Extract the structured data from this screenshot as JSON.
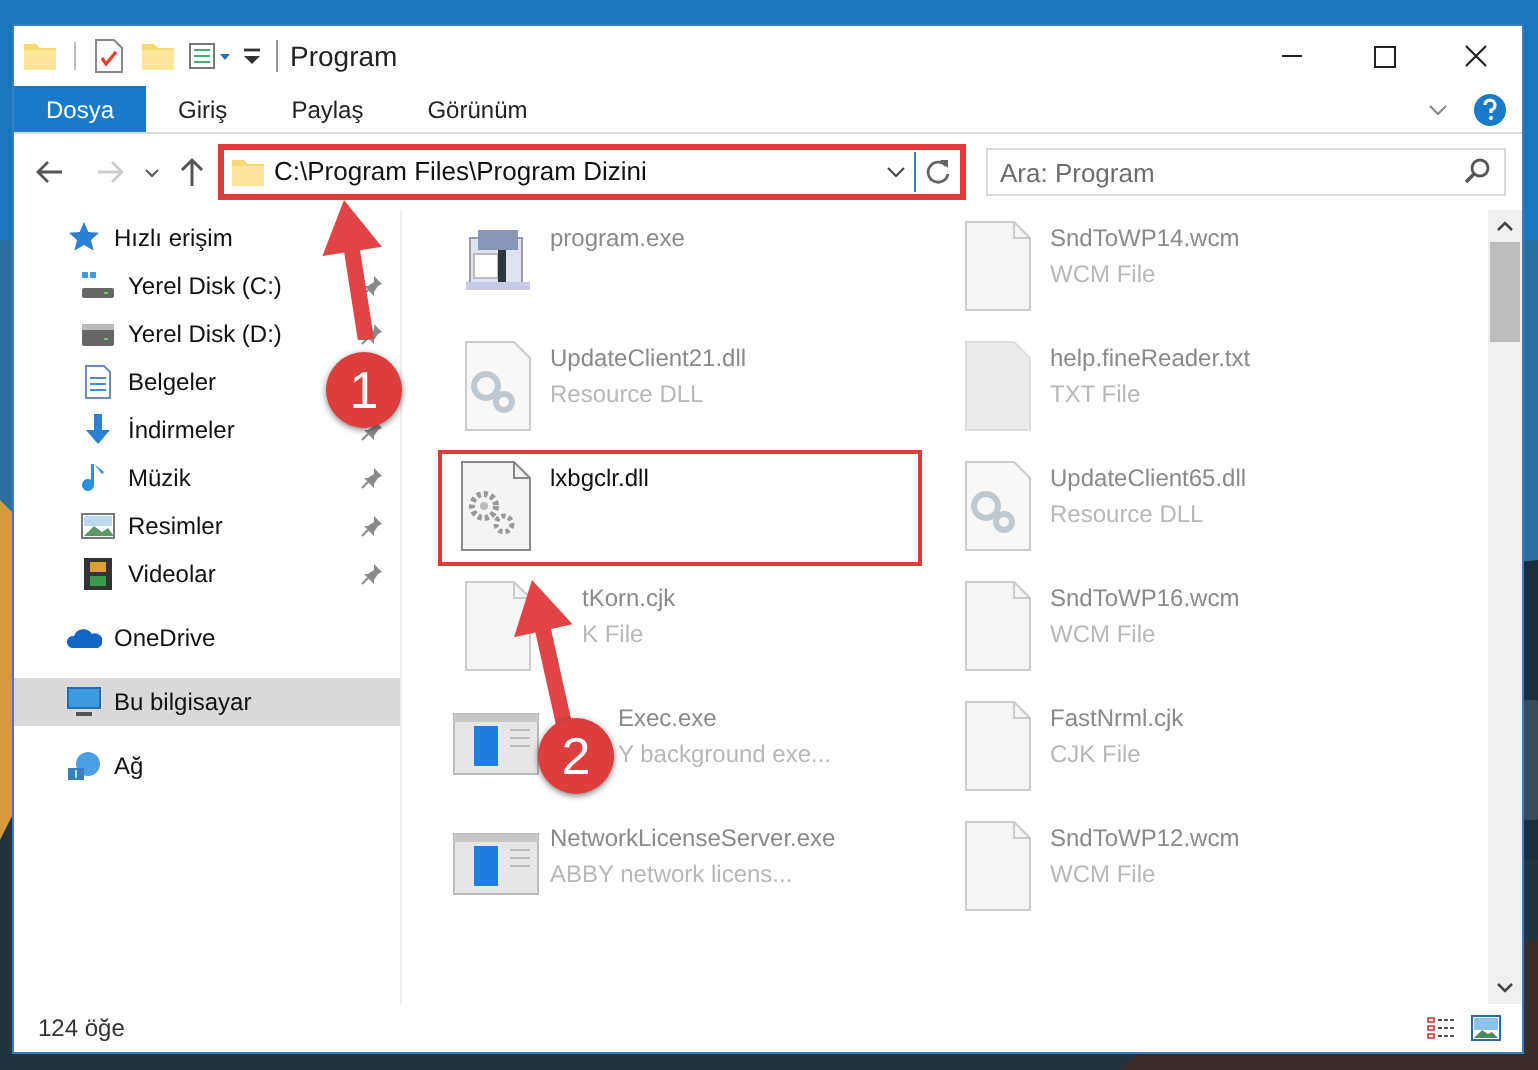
{
  "window": {
    "title": "Program"
  },
  "ribbon_tabs": [
    {
      "label": "Dosya",
      "selected": true
    },
    {
      "label": "Giriş",
      "selected": false
    },
    {
      "label": "Paylaş",
      "selected": false
    },
    {
      "label": "Görünüm",
      "selected": false
    }
  ],
  "address": {
    "path": "C:\\Program Files\\Program Dizini",
    "highlighted": true
  },
  "search": {
    "placeholder": "Ara: Program"
  },
  "sidebar": {
    "items": [
      {
        "label": "Hızlı erişim",
        "selected": false,
        "children": [
          {
            "label": "Yerel Disk (C:)",
            "pinned": true,
            "selected": false
          },
          {
            "label": "Yerel Disk (D:)",
            "pinned": true,
            "selected": false
          },
          {
            "label": "Belgeler",
            "selected": false
          },
          {
            "label": "İndirmeler",
            "pinned": true,
            "selected": false
          },
          {
            "label": "Müzik",
            "pinned": true,
            "selected": false
          },
          {
            "label": "Resimler",
            "pinned": true,
            "selected": false
          },
          {
            "label": "Videolar",
            "pinned": true,
            "selected": false
          }
        ]
      },
      {
        "label": "OneDrive",
        "selected": false
      },
      {
        "label": "Bu bilgisayar",
        "selected": true
      },
      {
        "label": "Ağ",
        "selected": false
      }
    ]
  },
  "files": [
    {
      "name": "program.exe",
      "highlighted": false
    },
    {
      "name": "SndToWP14.wcm",
      "type": "WCM File",
      "highlighted": false
    },
    {
      "name": "UpdateClient21.dll",
      "type": "Resource DLL",
      "highlighted": false
    },
    {
      "name": "help.fineReader.txt",
      "type": "TXT File",
      "highlighted": false
    },
    {
      "name": "lxbgclr.dll",
      "highlighted": true
    },
    {
      "name": "UpdateClient65.dll",
      "type": "Resource DLL",
      "highlighted": false
    },
    {
      "name": "tKorn.cjk",
      "type": "K File",
      "highlighted": false
    },
    {
      "name": "SndToWP16.wcm",
      "type": "WCM File",
      "highlighted": false
    },
    {
      "name": "Exec.exe",
      "type": "Y background exe...",
      "highlighted": false
    },
    {
      "name": "FastNrml.cjk",
      "type": "CJK File",
      "highlighted": false
    },
    {
      "name": "NetworkLicenseServer.exe",
      "type": "ABBY network licens...",
      "highlighted": false
    },
    {
      "name": "SndToWP12.wcm",
      "type": "WCM File",
      "highlighted": false
    }
  ],
  "status_bar": {
    "item_count": "124 öğe"
  },
  "annotations": [
    {
      "label": "1"
    },
    {
      "label": "2"
    }
  ]
}
